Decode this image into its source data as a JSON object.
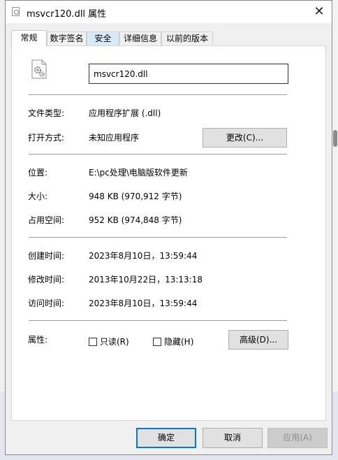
{
  "window": {
    "title": "msvcr120.dll 属性",
    "close_label": "✕"
  },
  "tabs": [
    "常规",
    "数字签名",
    "安全",
    "详细信息",
    "以前的版本"
  ],
  "general": {
    "file_name": "msvcr120.dll",
    "file_type_label": "文件类型:",
    "file_type_value": "应用程序扩展 (.dll)",
    "open_with_label": "打开方式:",
    "open_with_value": "未知应用程序",
    "change_button": "更改(C)...",
    "location_label": "位置:",
    "location_value": "E:\\pc处理\\电脑版软件更新",
    "size_label": "大小:",
    "size_value": "948 KB (970,912 字节)",
    "size_on_disk_label": "占用空间:",
    "size_on_disk_value": "952 KB (974,848 字节)",
    "created_label": "创建时间:",
    "created_value": "2023年8月10日，13:59:44",
    "modified_label": "修改时间:",
    "modified_value": "2013年10月22日，13:13:18",
    "accessed_label": "访问时间:",
    "accessed_value": "2023年8月10日，13:59:44",
    "attributes_label": "属性:",
    "readonly_label": "只读(R)",
    "hidden_label": "隐藏(H)",
    "advanced_button": "高级(D)..."
  },
  "footer": {
    "ok": "确定",
    "cancel": "取消",
    "apply": "应用(A)"
  },
  "colors": {
    "accent": "#0078d7",
    "tab_hover": "#d8eaf9"
  }
}
